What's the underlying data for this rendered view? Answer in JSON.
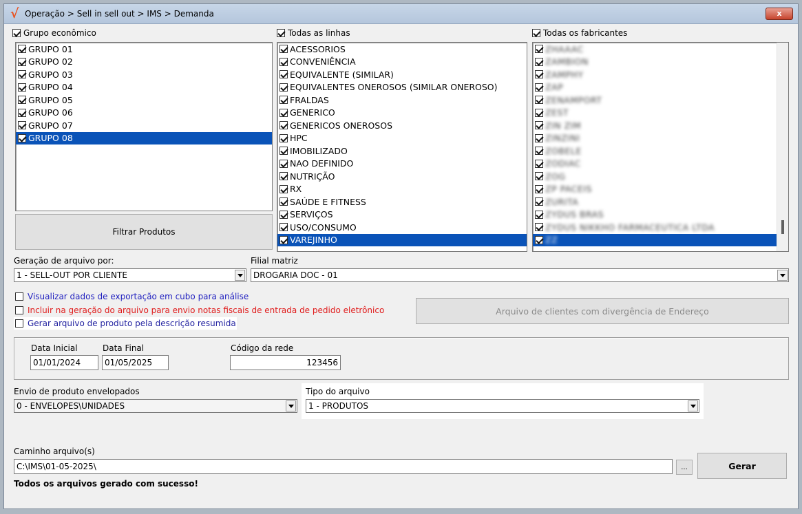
{
  "window": {
    "logo_glyph": "√",
    "title": "Operação > Sell in sell out > IMS > Demanda",
    "close_glyph": "x"
  },
  "group_panel": {
    "header": "Grupo econômico",
    "items": [
      {
        "label": "GRUPO 01",
        "checked": true
      },
      {
        "label": "GRUPO 02",
        "checked": true
      },
      {
        "label": "GRUPO 03",
        "checked": true
      },
      {
        "label": "GRUPO 04",
        "checked": true
      },
      {
        "label": "GRUPO 05",
        "checked": true
      },
      {
        "label": "GRUPO 06",
        "checked": true
      },
      {
        "label": "GRUPO 07",
        "checked": true
      },
      {
        "label": "GRUPO 08",
        "checked": true,
        "selected": true
      }
    ]
  },
  "lines_panel": {
    "header": "Todas as linhas",
    "items": [
      {
        "label": "ACESSORIOS",
        "checked": true
      },
      {
        "label": "CONVENIÊNCIA",
        "checked": true
      },
      {
        "label": "EQUIVALENTE (SIMILAR)",
        "checked": true
      },
      {
        "label": "EQUIVALENTES ONEROSOS (SIMILAR ONEROSO)",
        "checked": true
      },
      {
        "label": "FRALDAS",
        "checked": true
      },
      {
        "label": "GENERICO",
        "checked": true
      },
      {
        "label": "GENERICOS ONEROSOS",
        "checked": true
      },
      {
        "label": "HPC",
        "checked": true
      },
      {
        "label": "IMOBILIZADO",
        "checked": true
      },
      {
        "label": "NAO DEFINIDO",
        "checked": true
      },
      {
        "label": "NUTRIÇÃO",
        "checked": true
      },
      {
        "label": "RX",
        "checked": true
      },
      {
        "label": "SAÚDE E FITNESS",
        "checked": true
      },
      {
        "label": "SERVIÇOS",
        "checked": true
      },
      {
        "label": "USO/CONSUMO",
        "checked": true
      },
      {
        "label": "VAREJINHO",
        "checked": true,
        "selected": true
      }
    ]
  },
  "manufacturers_panel": {
    "header": "Todas os fabricantes",
    "items": [
      {
        "label": "ZHAAAC",
        "checked": true
      },
      {
        "label": "ZAMBION",
        "checked": true
      },
      {
        "label": "ZAMPHY",
        "checked": true
      },
      {
        "label": "ZAP",
        "checked": true
      },
      {
        "label": "ZENAMPORT",
        "checked": true
      },
      {
        "label": "ZEST",
        "checked": true
      },
      {
        "label": "ZIN ZIM",
        "checked": true
      },
      {
        "label": "ZINZINI",
        "checked": true
      },
      {
        "label": "ZOBELE",
        "checked": true
      },
      {
        "label": "ZODIAC",
        "checked": true
      },
      {
        "label": "ZOG",
        "checked": true
      },
      {
        "label": "ZP PACEIS",
        "checked": true
      },
      {
        "label": "ZURITA",
        "checked": true
      },
      {
        "label": "ZYDUS BRAS",
        "checked": true
      },
      {
        "label": "ZYDUS NIKKHO FARMACEUTICA LTDA",
        "checked": true
      },
      {
        "label": "ZZ",
        "checked": true,
        "selected": true
      }
    ]
  },
  "filter_products_button": "Filtrar Produtos",
  "generation": {
    "label": "Geração de arquivo por:",
    "value": "1 - SELL-OUT POR CLIENTE"
  },
  "branch": {
    "label": "Filial matriz",
    "value": "DROGARIA DOC - 01"
  },
  "options": [
    {
      "label": "Visualizar dados de exportação em cubo para análise",
      "checked": false,
      "color": "#1f1fbf"
    },
    {
      "label": "Incluir na geração do arquivo para envio notas fiscais de entrada de pedido eletrônico",
      "checked": false,
      "color": "#e01b1b"
    },
    {
      "label": "Gerar arquivo de produto pela descrição resumida",
      "checked": false,
      "color": "#1f1f9f"
    }
  ],
  "divergence_button": "Arquivo de clientes com divergência de Endereço",
  "dates": {
    "start_label": "Data Inicial",
    "start_value": "01/01/2024",
    "end_label": "Data Final",
    "end_value": "01/05/2025",
    "network_label": "Código da rede",
    "network_value": "123456"
  },
  "envelope": {
    "label": "Envio de produto envelopados",
    "value": "0 - ENVELOPES\\UNIDADES"
  },
  "file_type": {
    "label": "Tipo do arquivo",
    "value": "1 - PRODUTOS"
  },
  "path": {
    "label": "Caminho arquivo(s)",
    "value": "C:\\IMS\\01-05-2025\\",
    "browse_label": "...",
    "generate_label": "Gerar"
  },
  "status": "Todos os arquivos gerado com sucesso!"
}
